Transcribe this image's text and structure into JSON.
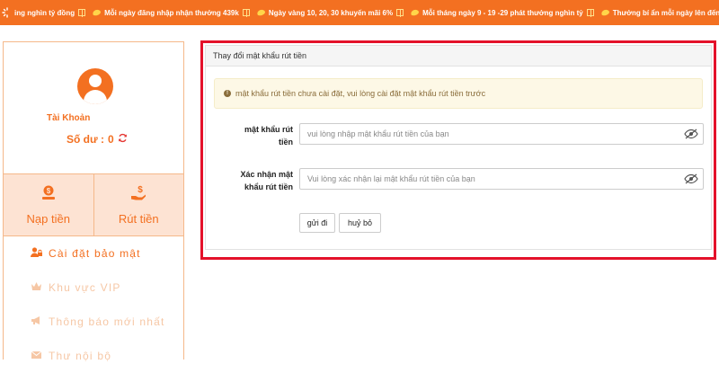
{
  "ticker": {
    "items": [
      "ing nghìn tỷ đồng",
      "Mỗi ngày đăng nhập nhận thưởng 439k",
      "Ngày vàng 10, 20, 30 khuyến mãi 6%",
      "Mỗi tháng ngày 9 - 19 -29 phát thưởng nghìn tỷ",
      "Thưởng bí ẩn mỗi ngày lên đến nghìn tỷ"
    ]
  },
  "sidebar": {
    "account_label": "Tài Khoản",
    "balance_label": "Số dư :",
    "balance_value": "0",
    "actions": [
      {
        "label": "Nạp tiền",
        "icon": "deposit-icon"
      },
      {
        "label": "Rút tiền",
        "icon": "withdraw-icon"
      }
    ],
    "menu": [
      {
        "label": "Cài đặt bảo mật",
        "icon": "user-lock-icon",
        "active": true
      },
      {
        "label": "Khu vực VIP",
        "icon": "crown-icon",
        "active": false
      },
      {
        "label": "Thông báo mới nhất",
        "icon": "megaphone-icon",
        "active": false
      },
      {
        "label": "Thư nội bộ",
        "icon": "envelope-icon",
        "active": false
      }
    ]
  },
  "panel": {
    "title": "Thay đổi mật khẩu rút tiền",
    "alert": "mật khẩu rút tiền chưa cài đặt, vui lòng cài đặt mật khẩu rút tiền trước",
    "fields": [
      {
        "label_line1": "mật khẩu rút",
        "label_line2": "tiền",
        "placeholder": "vui lòng nhập mật khẩu rút tiền của bạn",
        "value": ""
      },
      {
        "label_line1": "Xác nhận mật",
        "label_line2": "khẩu rút tiền",
        "placeholder": "Vui lòng xác nhận lại mật khẩu rút tiền của bạn",
        "value": ""
      }
    ],
    "submit_label": "gửi đi",
    "cancel_label": "huỷ bỏ"
  },
  "colors": {
    "brand": "#f37021",
    "highlight_border": "#e4112a",
    "alert_bg": "#fdf8e6",
    "action_bg": "#fde3d3"
  }
}
